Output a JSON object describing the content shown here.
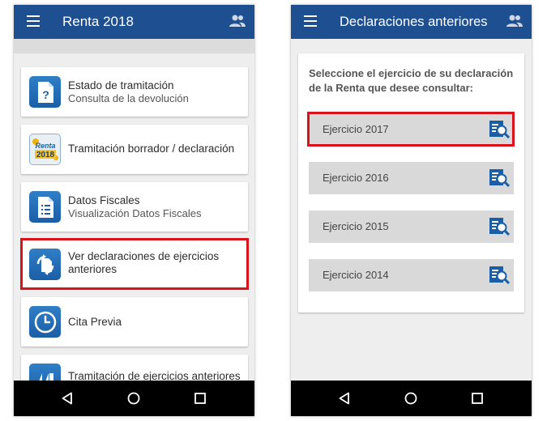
{
  "left_phone": {
    "appbar": {
      "title": "Renta 2018",
      "menu_icon": "hamburger-menu-icon",
      "account_icon": "people-icon",
      "color": "#1d4f91"
    },
    "cards": [
      {
        "title": "Estado de tramitación",
        "subtitle": "Consulta de la devolución",
        "icon": "document-question-icon"
      },
      {
        "title": "Tramitación borrador / declaración",
        "subtitle": "",
        "icon": "renta-2018-logo-icon",
        "logo_text": "Renta 2018"
      },
      {
        "title": "Datos Fiscales",
        "subtitle": "Visualización Datos Fiscales",
        "icon": "document-list-icon"
      },
      {
        "title": "Ver declaraciones de ejercicios anteriores",
        "subtitle": "",
        "icon": "refresh-document-icon",
        "highlighted": true
      },
      {
        "title": "Cita Previa",
        "subtitle": "",
        "icon": "clock-icon"
      },
      {
        "title": "Tramitación de ejercicios anteriores",
        "subtitle": "",
        "icon": "archive-icon"
      }
    ]
  },
  "right_phone": {
    "appbar": {
      "title": "Declaraciones anteriores",
      "menu_icon": "hamburger-menu-icon",
      "account_icon": "people-icon",
      "color": "#1d4f91"
    },
    "prompt": "Seleccione el ejercicio de su declaración de la Renta que desee consultar:",
    "years": [
      {
        "label": "Ejercicio 2017",
        "icon": "search-document-icon",
        "highlighted": true
      },
      {
        "label": "Ejercicio 2016",
        "icon": "search-document-icon"
      },
      {
        "label": "Ejercicio 2015",
        "icon": "search-document-icon"
      },
      {
        "label": "Ejercicio 2014",
        "icon": "search-document-icon"
      }
    ]
  },
  "navigation_bar": {
    "back_icon": "back-triangle-icon",
    "home_icon": "home-circle-icon",
    "recents_icon": "recents-square-icon"
  },
  "colors": {
    "highlight": "#d8131c",
    "primary": "#1d4f91",
    "icon_blue": "#2f7fc7"
  }
}
